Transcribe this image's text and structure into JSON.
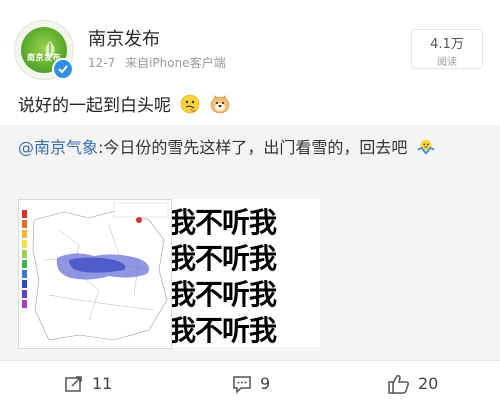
{
  "post": {
    "author": "南京发布",
    "avatar_caption": "南京发布",
    "date": "12-7",
    "source": "来自iPhone客户端",
    "reads_count": "4.1万",
    "reads_label": "阅读",
    "text": "说好的一起到白头呢"
  },
  "retweet": {
    "mention": "@南京气象",
    "text": ":今日份的雪先这样了，出门看雪的，回去吧",
    "meme_lines": [
      "我不听我",
      "我不听我",
      "我不听我",
      "我不听我"
    ]
  },
  "actions": {
    "repost_count": "11",
    "comment_count": "9",
    "like_count": "20"
  },
  "colors": {
    "link": "#3a6fb0",
    "verified": "#2d8fe6",
    "retweet_bg": "#f4f4f4"
  }
}
